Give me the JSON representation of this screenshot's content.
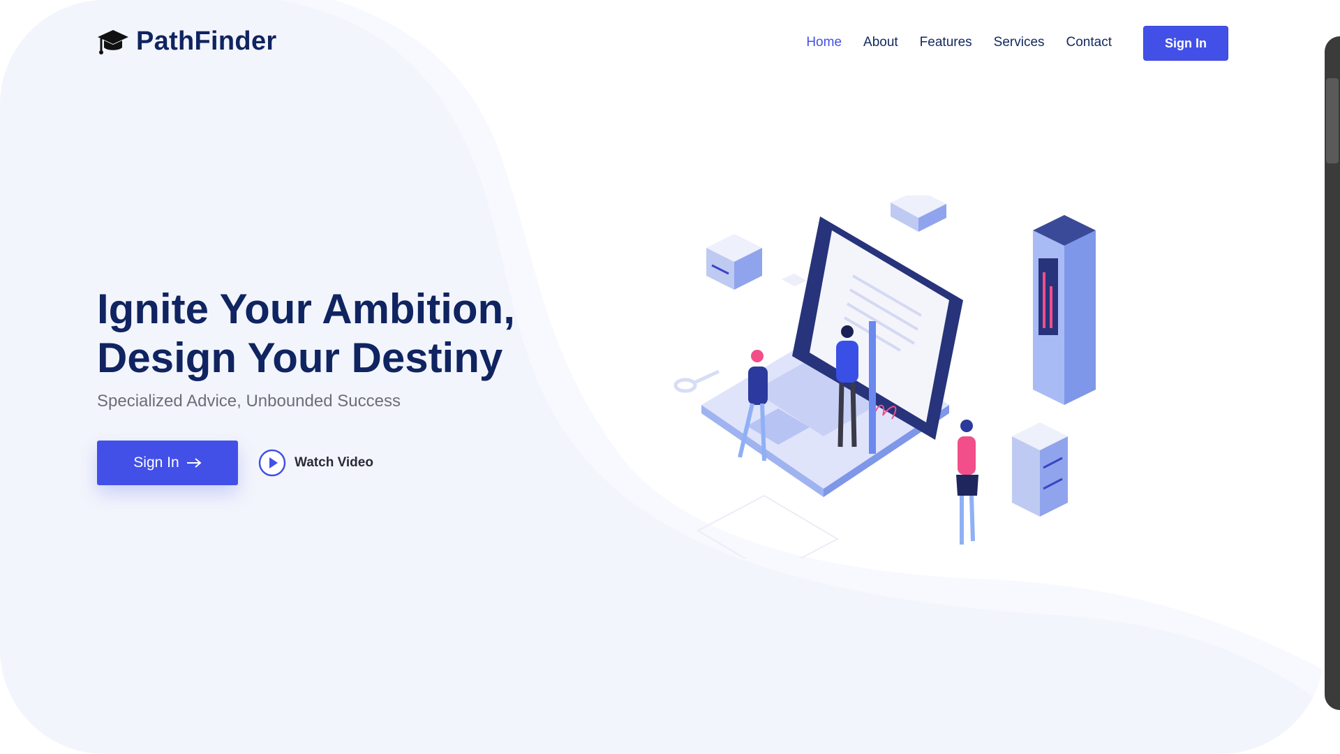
{
  "brand": {
    "name": "PathFinder",
    "logo_icon": "graduation-cap-icon"
  },
  "nav": {
    "items": [
      {
        "label": "Home",
        "active": true
      },
      {
        "label": "About",
        "active": false
      },
      {
        "label": "Features",
        "active": false
      },
      {
        "label": "Services",
        "active": false
      },
      {
        "label": "Contact",
        "active": false
      }
    ],
    "signin_label": "Sign In"
  },
  "hero": {
    "title_line1": "Ignite Your Ambition,",
    "title_line2": "Design Your Destiny",
    "subtitle": "Specialized Advice, Unbounded Success",
    "cta_label": "Sign In",
    "cta_icon": "arrow-right-icon",
    "video_label": "Watch Video",
    "video_icon": "play-circle-icon"
  },
  "colors": {
    "accent": "#4250e8",
    "heading": "#0f2460",
    "subtext": "#6d6d78",
    "background_wave": "#f3f5fc"
  }
}
